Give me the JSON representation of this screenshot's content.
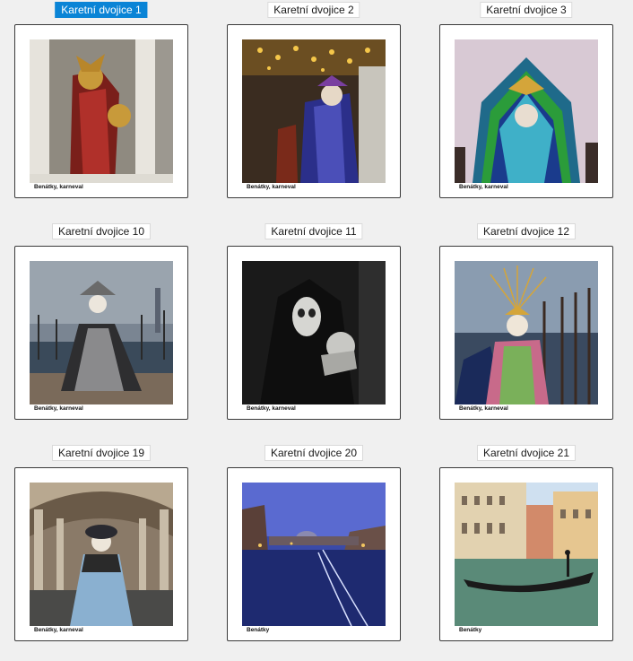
{
  "colors": {
    "selected_label_bg": "#0a84d6",
    "label_bg": "#ffffff",
    "page_bg": "#f0f0f0",
    "card_border": "#3a3a3a"
  },
  "cards": [
    {
      "label": "Karetní dvojice 1",
      "caption": "Benátky, karneval",
      "selected": true,
      "image": "venice-carnival-gold-masks-photo"
    },
    {
      "label": "Karetní dvojice 2",
      "caption": "Benátky, karneval",
      "selected": false,
      "image": "venice-carnival-blue-costume-lights-photo"
    },
    {
      "label": "Karetní dvojice 3",
      "caption": "Benátky, karneval",
      "selected": false,
      "image": "venice-carnival-peacock-feather-mask-photo"
    },
    {
      "label": "Karetní dvojice 10",
      "caption": "Benátky, karneval",
      "selected": false,
      "image": "venice-carnival-grey-gown-lagoon-photo"
    },
    {
      "label": "Karetní dvojice 11",
      "caption": "Benátky, karneval",
      "selected": false,
      "image": "venice-carnival-hooded-skull-mask-photo"
    },
    {
      "label": "Karetní dvojice 12",
      "caption": "Benátky, karneval",
      "selected": false,
      "image": "venice-carnival-golden-sun-crown-photo"
    },
    {
      "label": "Karetní dvojice 19",
      "caption": "Benátky, karneval",
      "selected": false,
      "image": "venice-carnival-arcade-blue-dress-photo"
    },
    {
      "label": "Karetní dvojice 20",
      "caption": "Benátky",
      "selected": false,
      "image": "venice-grand-canal-night-photo"
    },
    {
      "label": "Karetní dvojice 21",
      "caption": "Benátky",
      "selected": false,
      "image": "venice-gondola-canal-day-photo"
    }
  ]
}
